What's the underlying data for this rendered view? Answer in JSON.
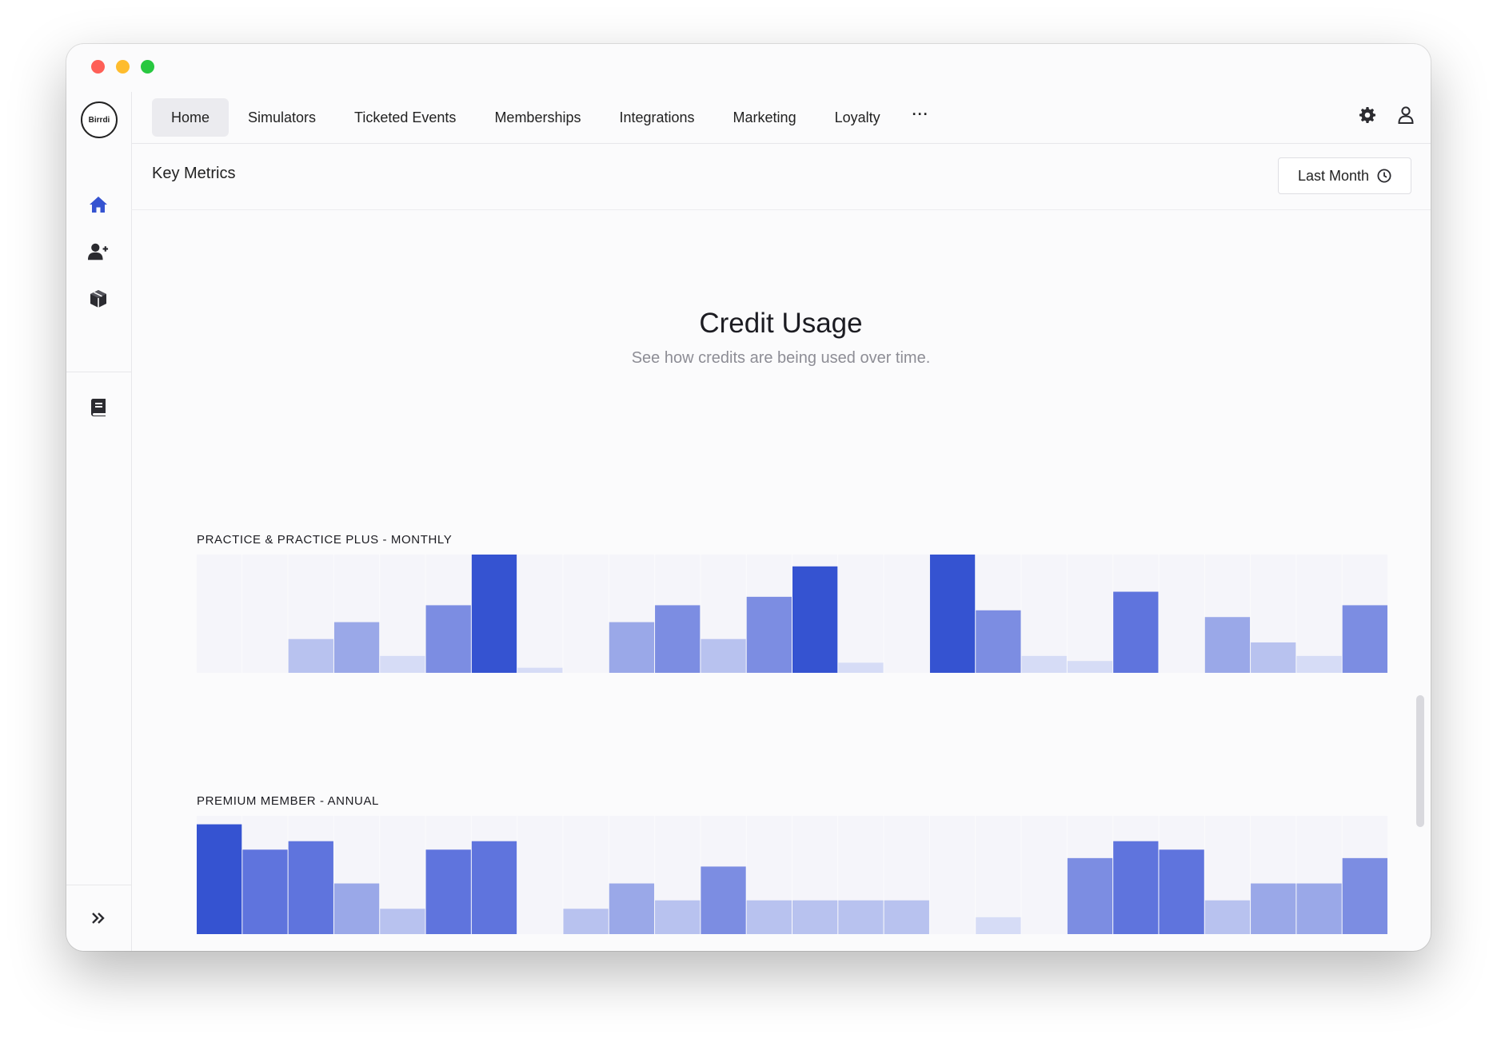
{
  "app": {
    "logo_text": "Birrdi"
  },
  "nav": {
    "tabs": [
      {
        "label": "Home",
        "active": true
      },
      {
        "label": "Simulators",
        "active": false
      },
      {
        "label": "Ticketed Events",
        "active": false
      },
      {
        "label": "Memberships",
        "active": false
      },
      {
        "label": "Integrations",
        "active": false
      },
      {
        "label": "Marketing",
        "active": false
      },
      {
        "label": "Loyalty",
        "active": false
      }
    ],
    "more_label": "···",
    "right_icons": [
      "gear-icon",
      "user-icon"
    ]
  },
  "sidebar": {
    "icons": [
      "home-icon",
      "add-user-icon",
      "box-icon",
      "book-icon"
    ],
    "expand_icon": "double-chevron-right-icon"
  },
  "header": {
    "title": "Key Metrics",
    "range_button": "Last Month",
    "range_icon": "clock-icon"
  },
  "main": {
    "title": "Credit Usage",
    "subtitle": "See how credits are being used over time."
  },
  "colors": {
    "accent": "#3553d1",
    "bar_scale": [
      "#d6dcf6",
      "#b8c2ef",
      "#9aa8e8",
      "#7c8de2",
      "#5f74dd",
      "#3553d1"
    ],
    "cell_background": "#f5f5fa"
  },
  "chart_data": [
    {
      "type": "bar",
      "title": "PRACTICE & PRACTICE PLUS - MONTHLY",
      "ylim": [
        0,
        7
      ],
      "values": [
        0,
        0,
        2,
        3,
        1,
        4,
        7,
        0.3,
        0,
        3,
        4,
        2,
        4.5,
        6.3,
        0.6,
        0,
        7,
        3.7,
        1,
        0.7,
        4.8,
        0,
        3.3,
        1.8,
        1,
        4
      ]
    },
    {
      "type": "bar",
      "title": "PREMIUM MEMBER - ANNUAL",
      "ylim": [
        0,
        7
      ],
      "values": [
        6.5,
        5,
        5.5,
        3,
        1.5,
        5,
        5.5,
        0,
        1.5,
        3,
        2,
        4,
        2,
        2,
        2,
        2,
        0,
        1,
        0,
        4.5,
        5.5,
        5,
        2,
        3,
        3,
        4.5
      ]
    }
  ]
}
